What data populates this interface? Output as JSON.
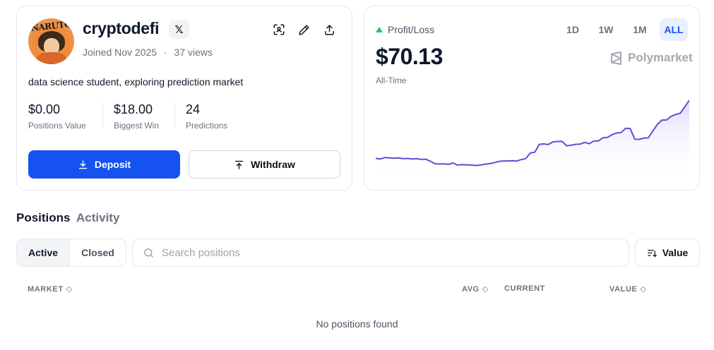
{
  "profile": {
    "avatar_text": "NARUTO",
    "username": "cryptodefi",
    "social_badge": "𝕏",
    "joined": "Joined Nov 2025",
    "separator": "·",
    "views": "37 views",
    "bio": "data science student, exploring prediction market",
    "stats": [
      {
        "value": "$0.00",
        "label": "Positions Value"
      },
      {
        "value": "$18.00",
        "label": "Biggest Win"
      },
      {
        "value": "24",
        "label": "Predictions"
      }
    ],
    "deposit_label": "Deposit",
    "withdraw_label": "Withdraw",
    "icons": [
      "qr-scan-icon",
      "pencil-icon",
      "share-icon"
    ]
  },
  "pnl": {
    "label": "Profit/Loss",
    "value": "$70.13",
    "period_label": "All-Time",
    "ranges": [
      "1D",
      "1W",
      "1M",
      "ALL"
    ],
    "active_range": "ALL",
    "brand": "Polymarket",
    "colors": {
      "line": "#5b4fd6",
      "fill": "#e6e4fb",
      "up": "#22c55e"
    }
  },
  "chart_data": {
    "type": "area",
    "x": [
      0,
      1,
      2,
      3,
      4,
      5,
      6,
      7,
      8,
      9,
      10,
      11,
      12,
      13,
      14,
      15,
      16,
      17,
      18,
      19,
      20,
      21,
      22,
      23,
      24,
      25,
      26,
      27,
      28,
      29,
      30,
      31,
      32,
      33,
      34,
      35,
      36,
      37,
      38,
      39,
      40,
      41,
      42,
      43,
      44,
      45,
      46,
      47,
      48,
      49,
      50,
      51,
      52,
      53,
      54,
      55,
      56,
      57,
      58,
      59,
      60,
      61,
      62,
      63,
      64,
      65,
      66,
      67,
      68,
      69
    ],
    "series": [
      {
        "values": [
          18.5,
          18.0,
          19.2,
          19.0,
          18.6,
          18.9,
          18.2,
          18.5,
          18.0,
          18.2,
          17.6,
          17.8,
          16.0,
          13.8,
          13.5,
          13.6,
          13.2,
          14.4,
          12.5,
          13.0,
          12.8,
          12.6,
          12.2,
          12.5,
          13.3,
          13.8,
          14.6,
          15.7,
          16.2,
          16.2,
          16.4,
          16.1,
          17.4,
          18.3,
          23.2,
          24.0,
          31.0,
          31.3,
          30.8,
          33.2,
          33.5,
          33.7,
          29.7,
          30.2,
          31.0,
          31.2,
          32.7,
          31.5,
          34.0,
          34.0,
          36.8,
          37.1,
          39.5,
          41.0,
          41.5,
          45.2,
          45.0,
          35.5,
          35.4,
          36.5,
          36.8,
          42.8,
          48.8,
          52.5,
          52.5,
          55.8,
          57.5,
          58.5,
          64.2,
          70.13
        ]
      }
    ],
    "ylim": [
      0,
      72
    ],
    "grid": false,
    "legend": "none"
  },
  "tabs": {
    "positions": "Positions",
    "activity": "Activity"
  },
  "filter": {
    "active": "Active",
    "closed": "Closed"
  },
  "search": {
    "placeholder": "Search positions"
  },
  "sort": {
    "label": "Value"
  },
  "table": {
    "headers": [
      {
        "label": "MARKET",
        "sortable": true
      },
      {
        "label": "AVG",
        "sortable": true
      },
      {
        "label": "CURRENT",
        "sortable": false
      },
      {
        "label": "VALUE",
        "sortable": true
      }
    ],
    "empty_message": "No positions found"
  }
}
